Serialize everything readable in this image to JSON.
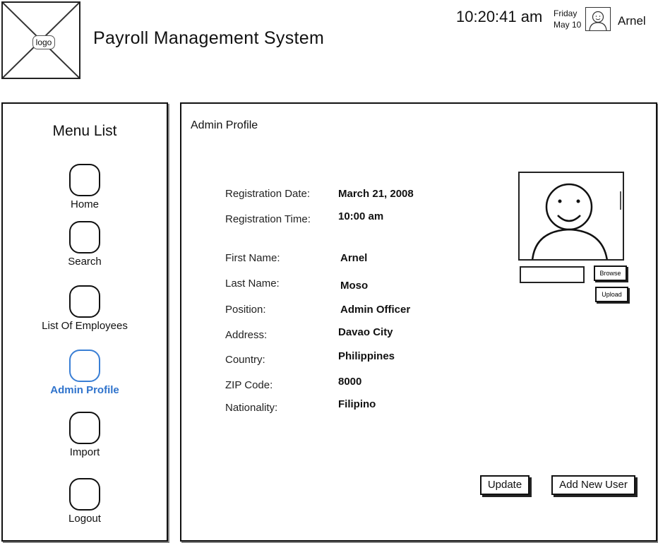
{
  "header": {
    "logo_text": "logo",
    "app_title": "Payroll Management System",
    "time": "10:20:41 am",
    "day": "Friday",
    "date": "May 10",
    "user_name": "Arnel"
  },
  "sidebar": {
    "title": "Menu List",
    "items": [
      {
        "label": "Home",
        "active": false
      },
      {
        "label": "Search",
        "active": false
      },
      {
        "label": "List Of Employees",
        "active": false
      },
      {
        "label": "Admin Profile",
        "active": true
      },
      {
        "label": "Import",
        "active": false
      },
      {
        "label": "Logout",
        "active": false
      }
    ]
  },
  "main": {
    "title": "Admin Profile",
    "fields": [
      {
        "label": "Registration Date:",
        "value": "March 21, 2008"
      },
      {
        "label": "Registration Time:",
        "value": "10:00 am"
      },
      {
        "label": "First Name:",
        "value": "Arnel"
      },
      {
        "label": "Last Name:",
        "value": "Moso"
      },
      {
        "label": "Position:",
        "value": "Admin Officer"
      },
      {
        "label": "Address:",
        "value": "Davao City"
      },
      {
        "label": "Country:",
        "value": "Philippines"
      },
      {
        "label": "ZIP Code:",
        "value": "8000"
      },
      {
        "label": "Nationality:",
        "value": "Filipino"
      }
    ],
    "photo": {
      "file_value": "",
      "browse_label": "Browse",
      "upload_label": "Upload"
    },
    "update_label": "Update",
    "add_user_label": "Add New User"
  },
  "colors": {
    "active_accent": "#2f73cc",
    "border": "#111111"
  }
}
